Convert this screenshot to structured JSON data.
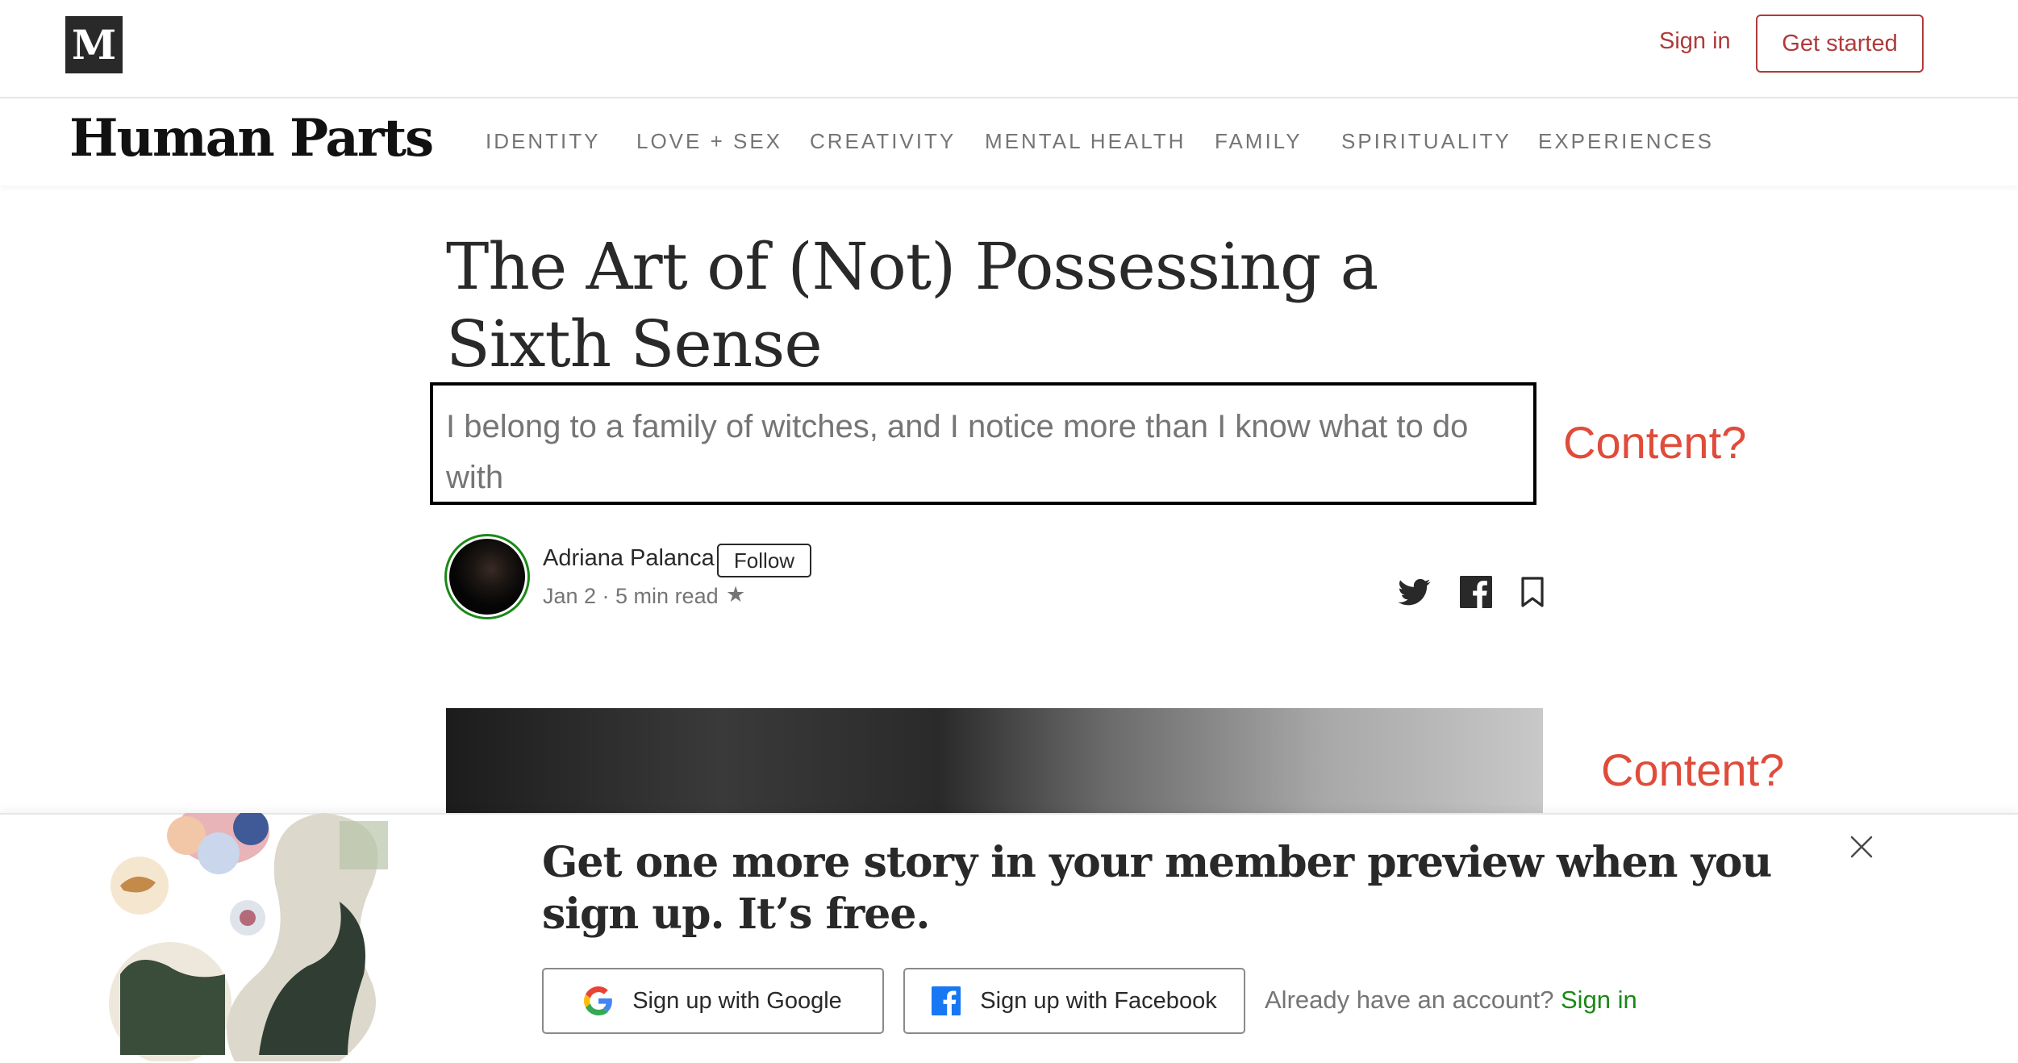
{
  "topbar": {
    "logo": "M",
    "signin_label": "Sign in",
    "getstarted_label": "Get started"
  },
  "publication": {
    "name": "Human Parts",
    "nav": [
      "IDENTITY",
      "LOVE + SEX",
      "CREATIVITY",
      "MENTAL HEALTH",
      "FAMILY",
      "SPIRITUALITY",
      "EXPERIENCES"
    ]
  },
  "article": {
    "title": "The Art of (Not) Possessing a Sixth Sense",
    "subtitle": "I belong to a family of witches, and I notice more than I know what to do with",
    "author": "Adriana Palanca",
    "follow_label": "Follow",
    "meta": "Jan 2 · 5 min read",
    "star": "★"
  },
  "annotations": {
    "first": "Content?",
    "second": "Content?"
  },
  "banner": {
    "title": "Get one more story in your member preview when you sign up. It’s free.",
    "google_label": "Sign up with Google",
    "facebook_label": "Sign up with Facebook",
    "already_text": "Already have an account?",
    "signin_label": "Sign in"
  },
  "colors": {
    "accent_red": "#b03a3a",
    "annotation_red": "#e04b3a",
    "green": "#1a8917",
    "facebook_blue": "#1877f2"
  },
  "icons": [
    "medium-logo-icon",
    "twitter-icon",
    "facebook-icon",
    "bookmark-icon",
    "close-icon",
    "google-icon",
    "facebook-icon"
  ]
}
